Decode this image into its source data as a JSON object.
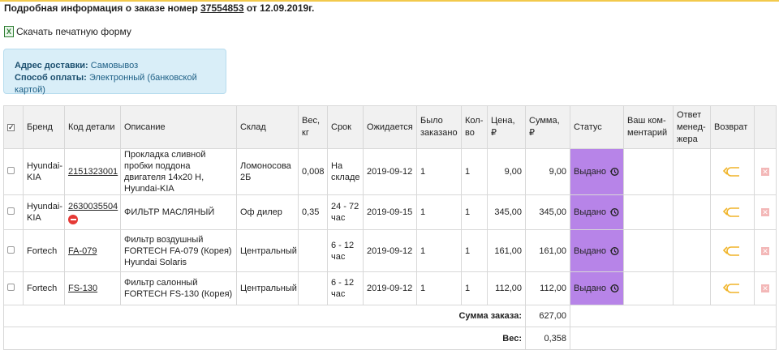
{
  "order": {
    "title_prefix": "Подробная информация о заказе номер",
    "number": "37554853",
    "date_text": "от 12.09.2019г."
  },
  "print_link": "Скачать печатную форму",
  "delivery": {
    "address_label": "Адрес доставки:",
    "address_value": "Самовывоз",
    "payment_label": "Способ оплаты:",
    "payment_value": "Электронный (банковской картой)"
  },
  "columns": {
    "brand": "Бренд",
    "code": "Код детали",
    "description": "Описание",
    "warehouse": "Склад",
    "weight": "Вес, кг",
    "term": "Срок",
    "expected": "Ожидается",
    "ordered": "Было заказано",
    "qty": "Кол-во",
    "price": "Цена, ₽",
    "sum": "Сумма, ₽",
    "status": "Статус",
    "comment": "Ваш ком-ментарий",
    "manager": "Ответ менед-жера",
    "return": "Возврат"
  },
  "rows": [
    {
      "brand": "Hyundai-KIA",
      "code": "2151323001",
      "description": "Прокладка сливной пробки поддона двигателя 14x20 H, Hyundai-KIA",
      "warehouse": "Ломоносова 2Б",
      "weight": "0,008",
      "term": "На складе",
      "expected": "2019-09-12",
      "ordered": "1",
      "qty": "1",
      "price": "9,00",
      "sum": "9,00",
      "status": "Выдано"
    },
    {
      "brand": "Hyundai-KIA",
      "code": "2630035504",
      "description": "ФИЛЬТР МАСЛЯНЫЙ",
      "warehouse": "Оф дилер",
      "weight": "0,35",
      "term": "24 - 72 час",
      "expected": "2019-09-15",
      "ordered": "1",
      "qty": "1",
      "price": "345,00",
      "sum": "345,00",
      "status": "Выдано"
    },
    {
      "brand": "Fortech",
      "code": "FA-079",
      "description": "Фильтр воздушный FORTECH FA-079 (Корея) Hyundai Solaris",
      "warehouse": "Центральный",
      "weight": "",
      "term": "6 - 12 час",
      "expected": "2019-09-12",
      "ordered": "1",
      "qty": "1",
      "price": "161,00",
      "sum": "161,00",
      "status": "Выдано"
    },
    {
      "brand": "Fortech",
      "code": "FS-130",
      "description": "Фильтр салонный FORTECH FS-130 (Корея)",
      "warehouse": "Центральный",
      "weight": "",
      "term": "6 - 12 час",
      "expected": "2019-09-12",
      "ordered": "1",
      "qty": "1",
      "price": "112,00",
      "sum": "112,00",
      "status": "Выдано"
    }
  ],
  "totals": {
    "sum_label": "Сумма заказа:",
    "sum_value": "627,00",
    "weight_label": "Вес:",
    "weight_value": "0,358"
  },
  "colors": {
    "status_bg": "#b784e8",
    "info_bg": "#d9eef8",
    "return_icon": "#f0b429",
    "accent_line": "#f2c94c"
  },
  "icons": [
    "excel-icon",
    "stop-icon",
    "history-icon",
    "return-arrow-icon",
    "delete-icon",
    "check-all-icon"
  ]
}
